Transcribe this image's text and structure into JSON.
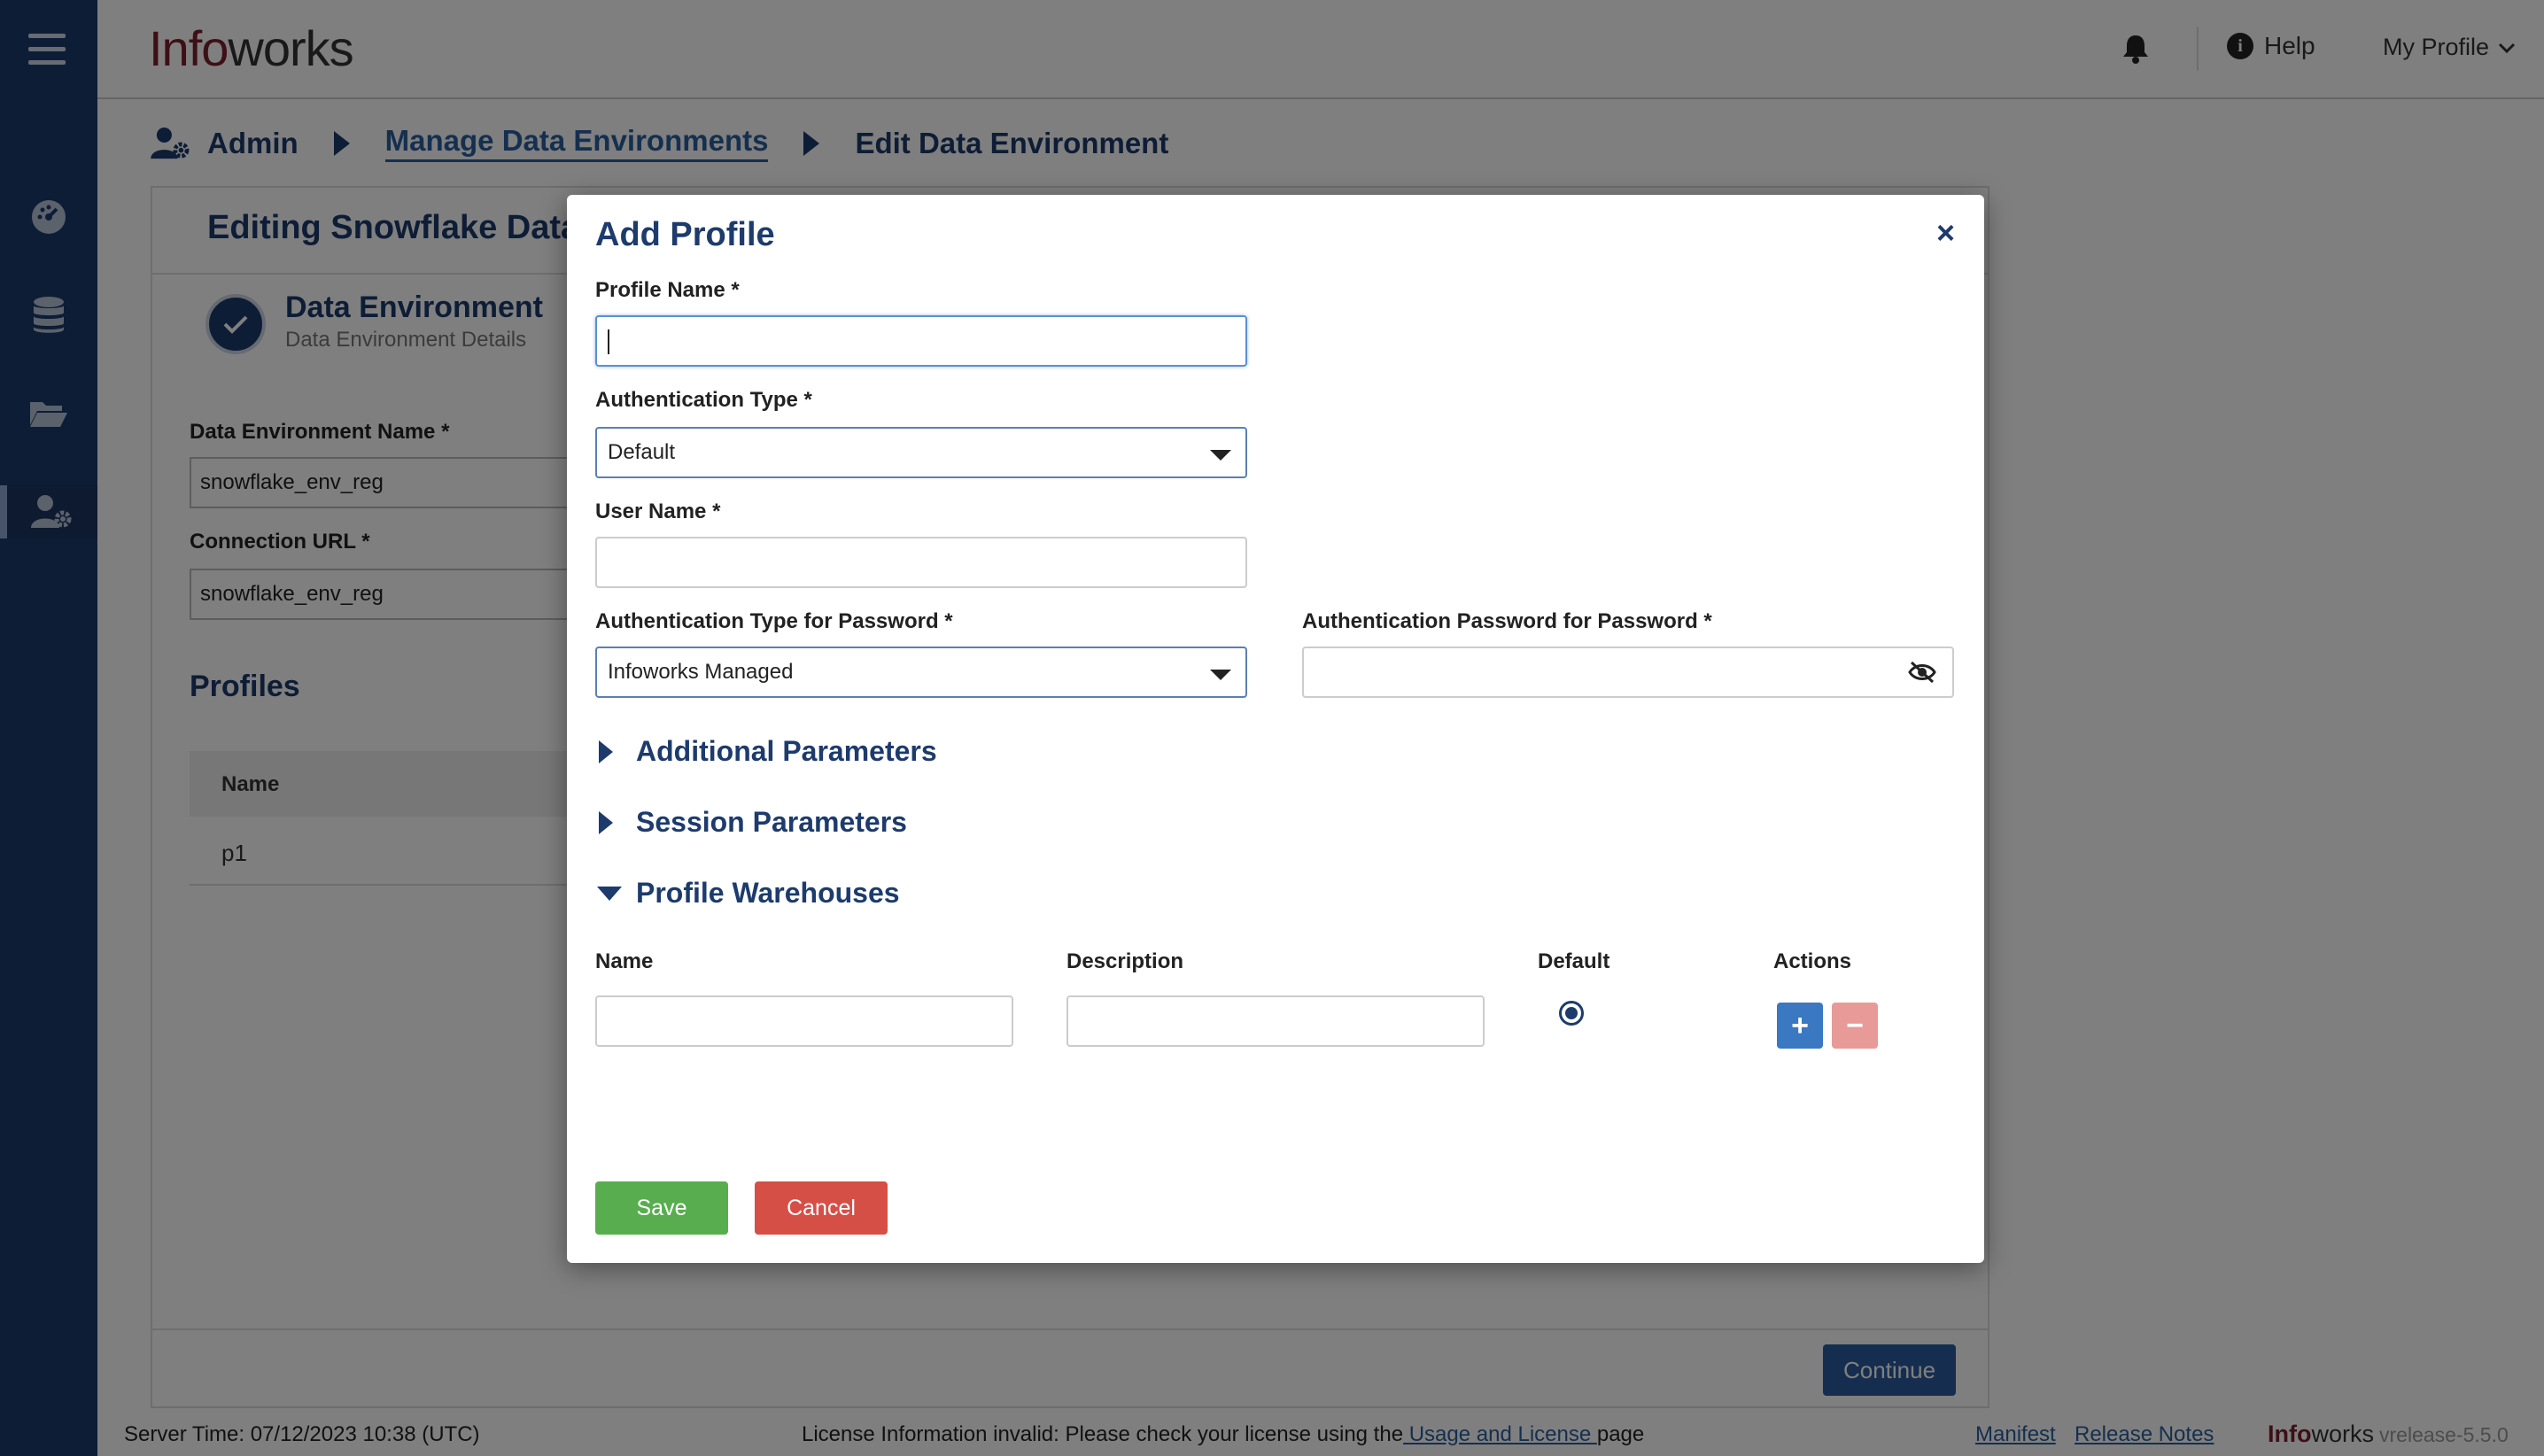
{
  "app": {
    "logo_part1": "Info",
    "logo_part2": "works"
  },
  "topbar": {
    "help_label": "Help",
    "profile_label": "My Profile"
  },
  "breadcrumb": {
    "item1": "Admin",
    "item2": "Manage Data Environments",
    "item3": "Edit Data Environment"
  },
  "page": {
    "title": "Editing Snowflake Data",
    "step_title": "Data Environment",
    "step_subtitle": "Data Environment Details",
    "env_name_label": "Data Environment Name *",
    "env_name_value": "snowflake_env_reg",
    "conn_url_label": "Connection URL *",
    "conn_url_value": "snowflake_env_reg",
    "profiles_heading": "Profiles",
    "table_header_name": "Name",
    "rows": [
      "p1"
    ],
    "continue_label": "Continue"
  },
  "modal": {
    "title": "Add Profile",
    "close_glyph": "×",
    "profile_name_label": "Profile Name *",
    "profile_name_value": "",
    "auth_type_label": "Authentication Type *",
    "auth_type_value": "Default",
    "user_name_label": "User Name *",
    "user_name_value": "",
    "auth_type_pw_label": "Authentication Type for Password *",
    "auth_type_pw_value": "Infoworks Managed",
    "auth_pw_label": "Authentication Password for Password *",
    "auth_pw_value": "",
    "section_additional": "Additional Parameters",
    "section_session": "Session Parameters",
    "section_warehouses": "Profile Warehouses",
    "wh_col_name": "Name",
    "wh_col_description": "Description",
    "wh_col_default": "Default",
    "wh_col_actions": "Actions",
    "add_glyph": "+",
    "remove_glyph": "−",
    "save_label": "Save",
    "cancel_label": "Cancel"
  },
  "status": {
    "server_time": "Server Time: 07/12/2023 10:38 (UTC)",
    "license_prefix": "License Information invalid: Please check your license using the",
    "license_link": " Usage and License ",
    "license_suffix": "page",
    "manifest": "Manifest",
    "release_notes": "Release Notes",
    "brand_part1": "Info",
    "brand_part2": "works",
    "version": "vrelease-5.5.0"
  },
  "colors": {
    "sidebar": "#1d3b6c",
    "accent": "#1d3b6c",
    "save": "#58ae4f",
    "cancel": "#d64f47"
  },
  "icons": [
    "hamburger-icon",
    "dashboard-icon",
    "database-icon",
    "folder-icon",
    "admin-user-icon",
    "bell-icon",
    "info-icon",
    "chevron-down-icon",
    "close-icon",
    "eye-slash-icon",
    "plus-icon",
    "minus-icon",
    "check-icon"
  ]
}
